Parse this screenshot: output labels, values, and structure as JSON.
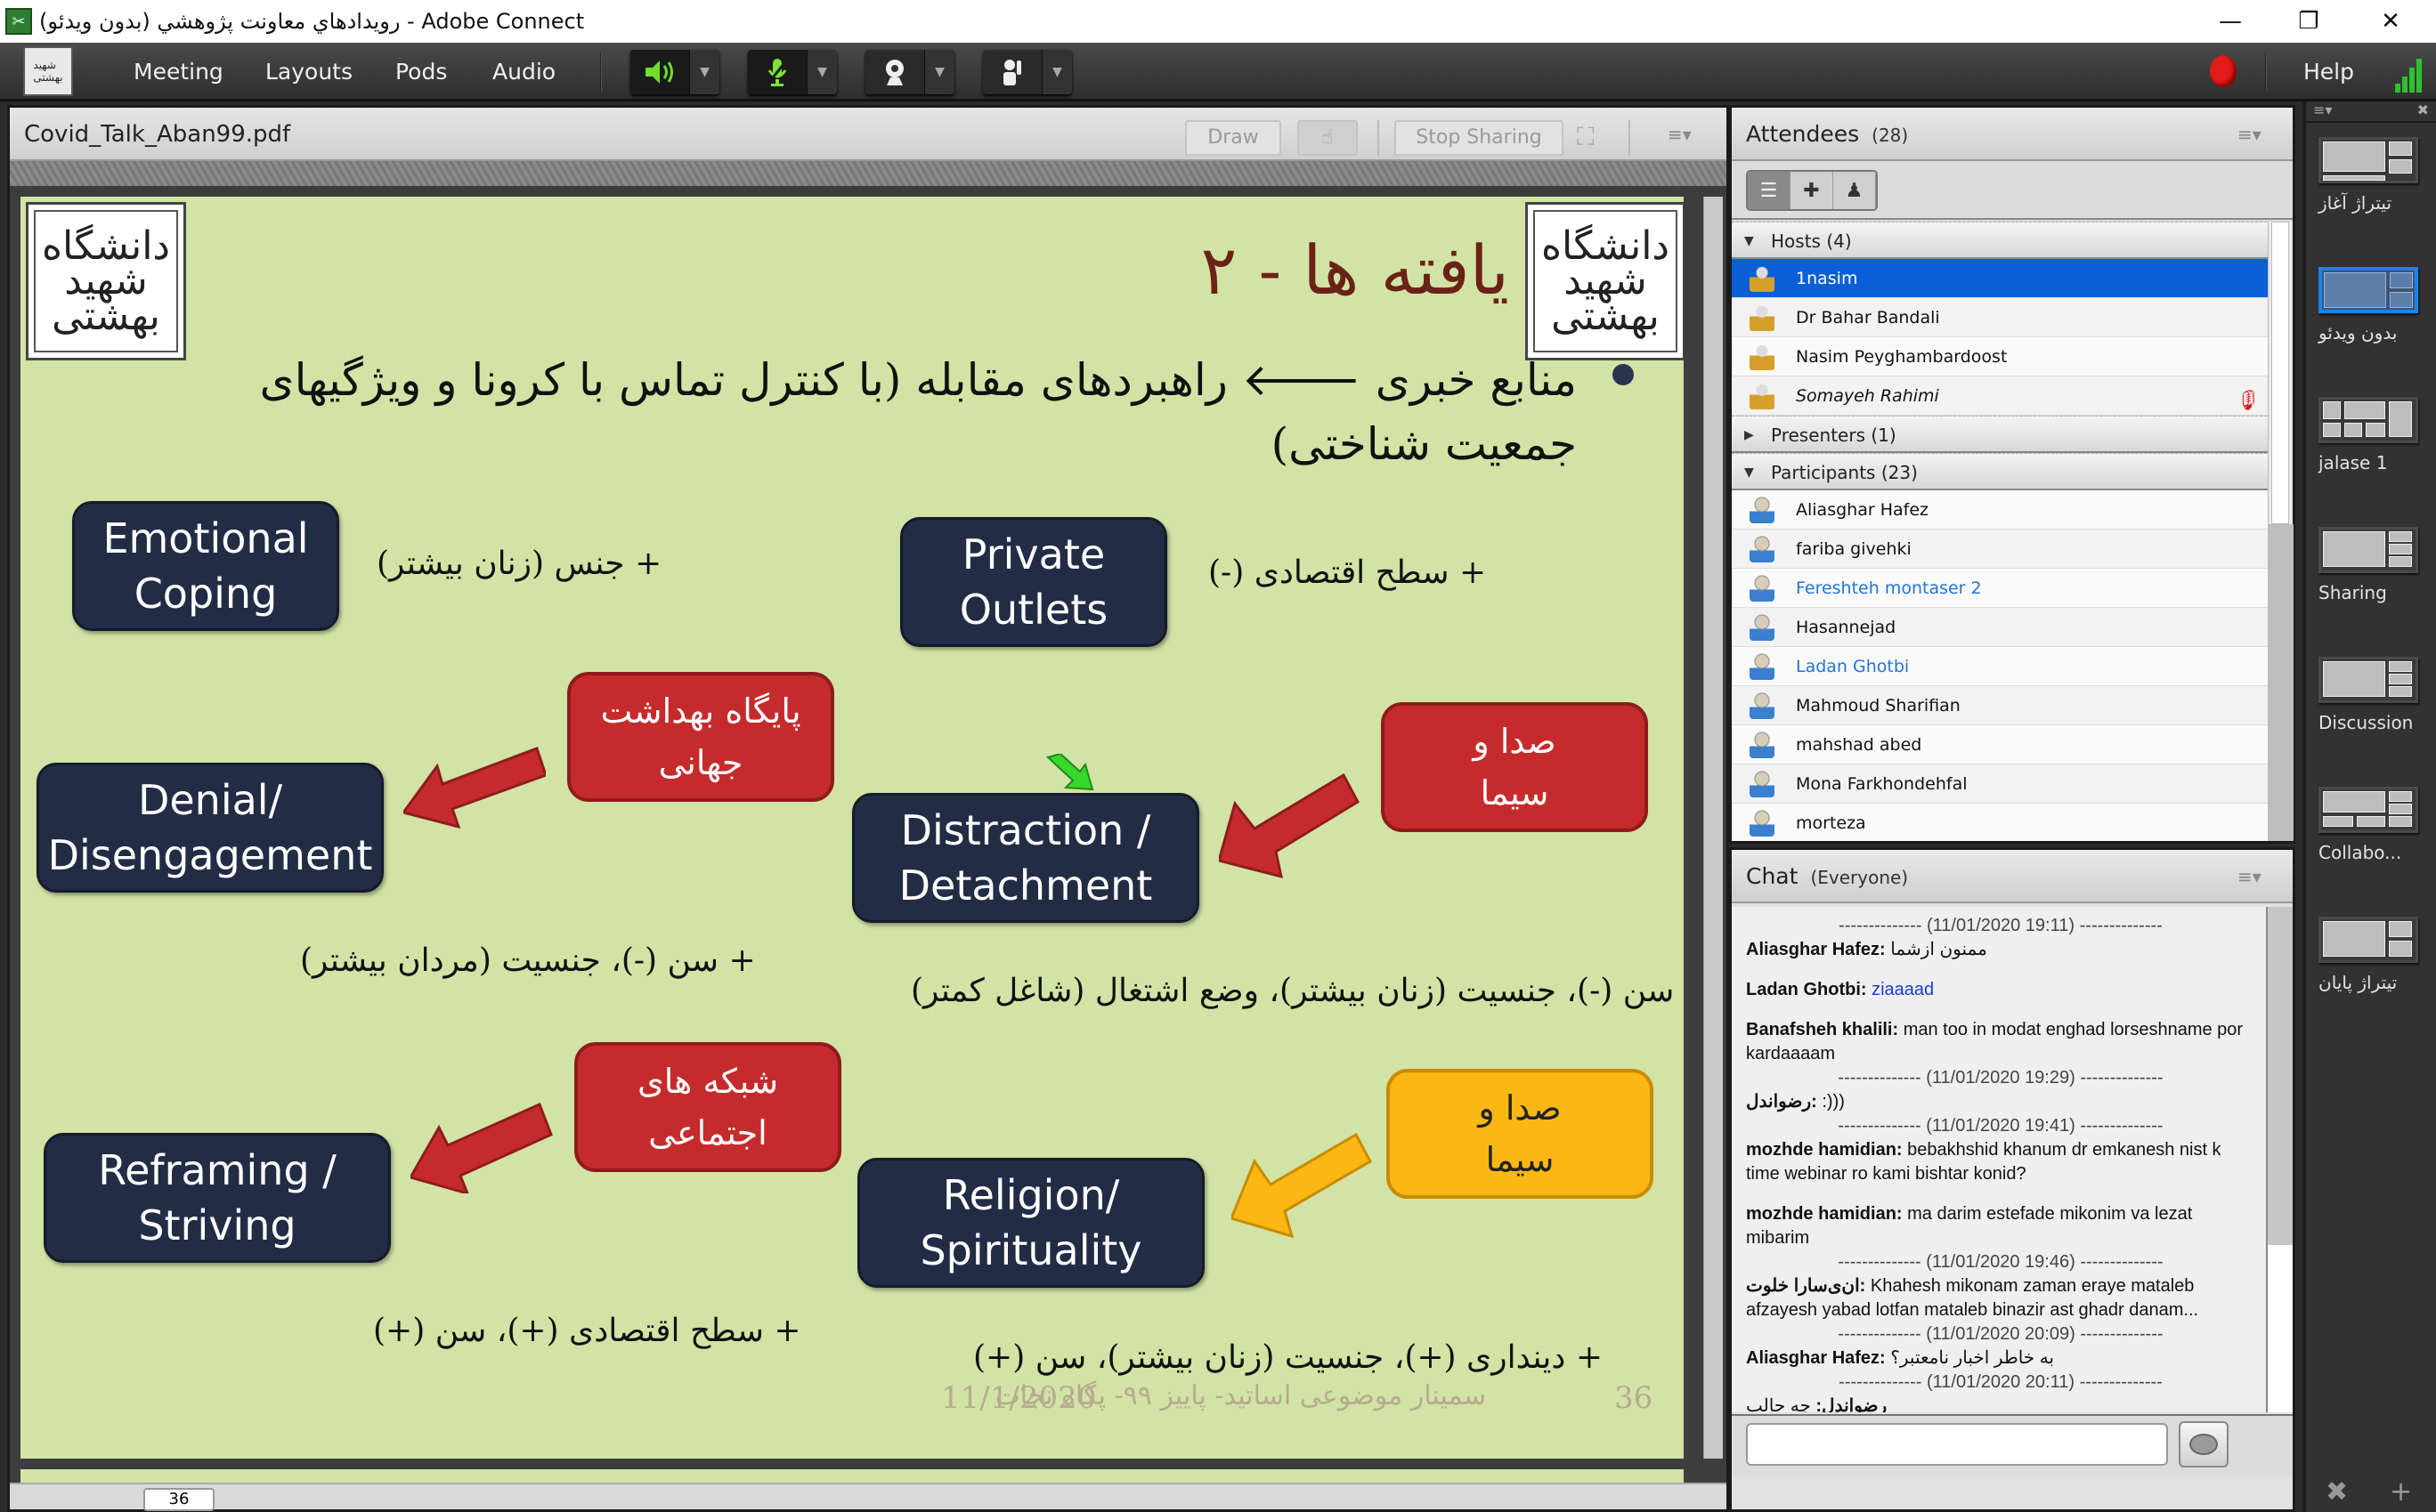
{
  "window": {
    "title": "رويدادهاي معاونت پژوهشي (بدون ويدئو) - Adobe Connect",
    "minimize_icon": "minimize-icon",
    "restore_icon": "restore-icon",
    "close_icon": "close-icon"
  },
  "menubar": {
    "items": [
      "Meeting",
      "Layouts",
      "Pods",
      "Audio"
    ],
    "help_label": "Help",
    "speaker_icon": "speaker-on-icon",
    "mic_icon": "microphone-muted-icon",
    "camera_icon": "webcam-icon",
    "raise_hand_icon": "raise-hand-icon",
    "record_icon": "record-indicator-icon",
    "signal_icon": "connection-strength-icon"
  },
  "share_pod": {
    "file_name": "Covid_Talk_Aban99.pdf",
    "draw_label": "Draw",
    "stop_sharing_label": "Stop Sharing",
    "current_page": "36",
    "slide": {
      "logo_text": "دانشگاه شهید بهشتی",
      "title": "یافته ها - ۲",
      "bullet_line1": "منابع خبری 🡐 راهبردهای مقابله (با کنترل تماس با کرونا و ویژگیهای",
      "bullet_line2": "جمعیت شناختی)",
      "strategies": [
        {
          "label": "Emotional Coping",
          "note": "+ جنس (زنان بیشتر)"
        },
        {
          "label": "Private Outlets",
          "note": "+ سطح اقتصادی (-)"
        },
        {
          "label": "Denial/ Disengagement",
          "note": "+ سن (-)، جنسیت (مردان بیشتر)"
        },
        {
          "label": "Distraction / Detachment",
          "note": "+ سن (-)، جنسیت (زنان بیشتر)، وضع اشتغال (شاغل کمتر)"
        },
        {
          "label": "Reframing / Striving",
          "note": "+ سطح اقتصادی (+)، سن (+)"
        },
        {
          "label": "Religion/ Spirituality",
          "note": "+ دینداری (+)، جنسیت (زنان بیشتر)، سن (+)"
        }
      ],
      "sources": [
        {
          "label": "پایگاه بهداشت جهانی",
          "color": "#c52b2d"
        },
        {
          "label": "صدا و سیما",
          "color": "#c52b2d"
        },
        {
          "label": "شبکه های اجتماعی",
          "color": "#c52b2d"
        },
        {
          "label": "صدا و سیما",
          "color": "#fbb713"
        }
      ],
      "footer_date": "11/1/2020",
      "footer_text": "سمینار موضوعی اساتید- پاییز ۹۹- پگاه نجات",
      "footer_page": "36"
    }
  },
  "attendees": {
    "title": "Attendees",
    "count": "(28)",
    "groups": {
      "hosts": "Hosts (4)",
      "presenters": "Presenters (1)",
      "participants": "Participants (23)"
    },
    "hosts": [
      "1nasim",
      "Dr Bahar Bandali",
      "Nasim Peyghambardoost",
      "Somayeh Rahimi"
    ],
    "participants": [
      "Aliasghar Hafez",
      "fariba givehki",
      "Fereshteh montaser 2",
      "Hasannejad",
      "Ladan Ghotbi",
      "Mahmoud Sharifian",
      "mahshad abed",
      "Mona Farkhondehfal",
      "morteza"
    ]
  },
  "chat": {
    "title": "Chat",
    "scope": "(Everyone)",
    "messages": [
      {
        "type": "divider",
        "text": "-------------- (11/01/2020 19:11) --------------"
      },
      {
        "type": "msg",
        "sender": "Aliasghar Hafez:",
        "text": " ممنون ازشما"
      },
      {
        "type": "msg",
        "sender": "Ladan Ghotbi:",
        "text": " ziaaaad",
        "blue": true,
        "gap": true
      },
      {
        "type": "msg",
        "sender": "Banafsheh khalili:",
        "text": " man too in modat enghad lorseshname por kardaaaam",
        "gap": true
      },
      {
        "type": "divider",
        "text": "-------------- (11/01/2020 19:29) --------------"
      },
      {
        "type": "msg",
        "sender": "رضواندل:",
        "text": " :)))"
      },
      {
        "type": "divider",
        "text": "-------------- (11/01/2020 19:41) --------------"
      },
      {
        "type": "msg",
        "sender": "mozhde hamidian:",
        "text": " bebakhshid khanum dr emkanesh nist k time webinar ro kami bishtar konid?"
      },
      {
        "type": "msg",
        "sender": "mozhde hamidian:",
        "text": " ma darim estefade mikonim va lezat mibarim",
        "gap": true
      },
      {
        "type": "divider",
        "text": "-------------- (11/01/2020 19:46) --------------"
      },
      {
        "type": "msg",
        "sender": "ان‌ی‌سارا خلوت:",
        "text": " Khahesh mikonam zaman eraye mataleb afzayesh yabad lotfan mataleb binazir ast ghadr danam..."
      },
      {
        "type": "divider",
        "text": "-------------- (11/01/2020 20:09) --------------"
      },
      {
        "type": "msg",
        "sender": "Aliasghar Hafez:",
        "text": " به خاطر اخبار نامعتبر؟"
      },
      {
        "type": "divider",
        "text": "-------------- (11/01/2020 20:11) --------------"
      },
      {
        "type": "msg",
        "sender": "رضواندل:",
        "text": " چه جالب"
      }
    ],
    "input_value": "",
    "send_icon": "send-message-icon"
  },
  "layouts": {
    "items": [
      {
        "label": "تیتراژ آغاز",
        "selected": false
      },
      {
        "label": "بدون ویدئو",
        "selected": true
      },
      {
        "label": "jalase 1",
        "selected": false
      },
      {
        "label": "Sharing",
        "selected": false
      },
      {
        "label": "Discussion",
        "selected": false
      },
      {
        "label": "Collabo...",
        "selected": false
      },
      {
        "label": "تیتراژ پایان",
        "selected": false
      }
    ]
  }
}
